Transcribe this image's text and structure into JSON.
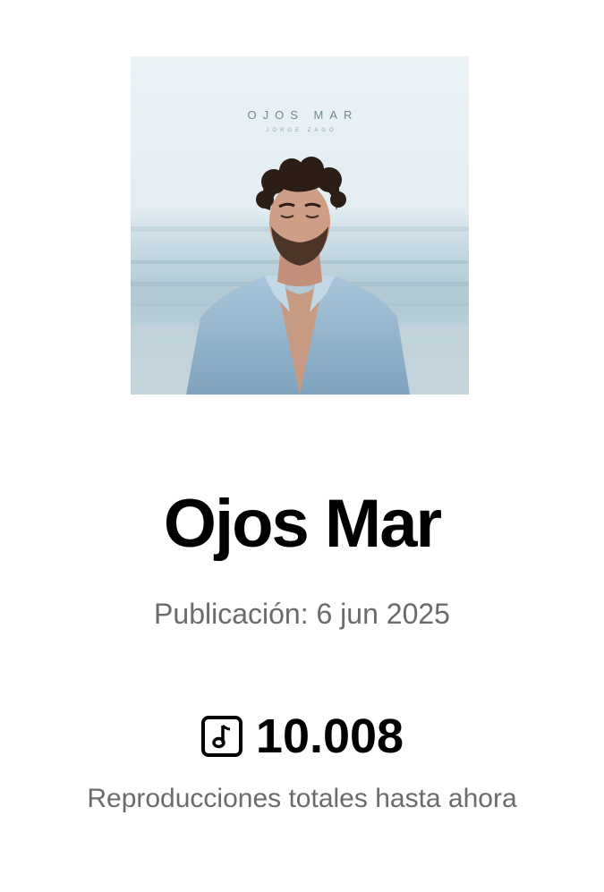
{
  "cover": {
    "title": "OJOS MAR",
    "artist": "JORGE ZAGO"
  },
  "song": {
    "title": "Ojos Mar",
    "release": "Publicación: 6 jun 2025"
  },
  "stats": {
    "icon": "music-note-icon",
    "count": "10.008",
    "label": "Reproducciones totales hasta ahora"
  },
  "colors": {
    "title": "#000000",
    "secondary_text": "#6b6b6b",
    "sky": "#e8f0f4",
    "sea": "#a9c3cf"
  }
}
